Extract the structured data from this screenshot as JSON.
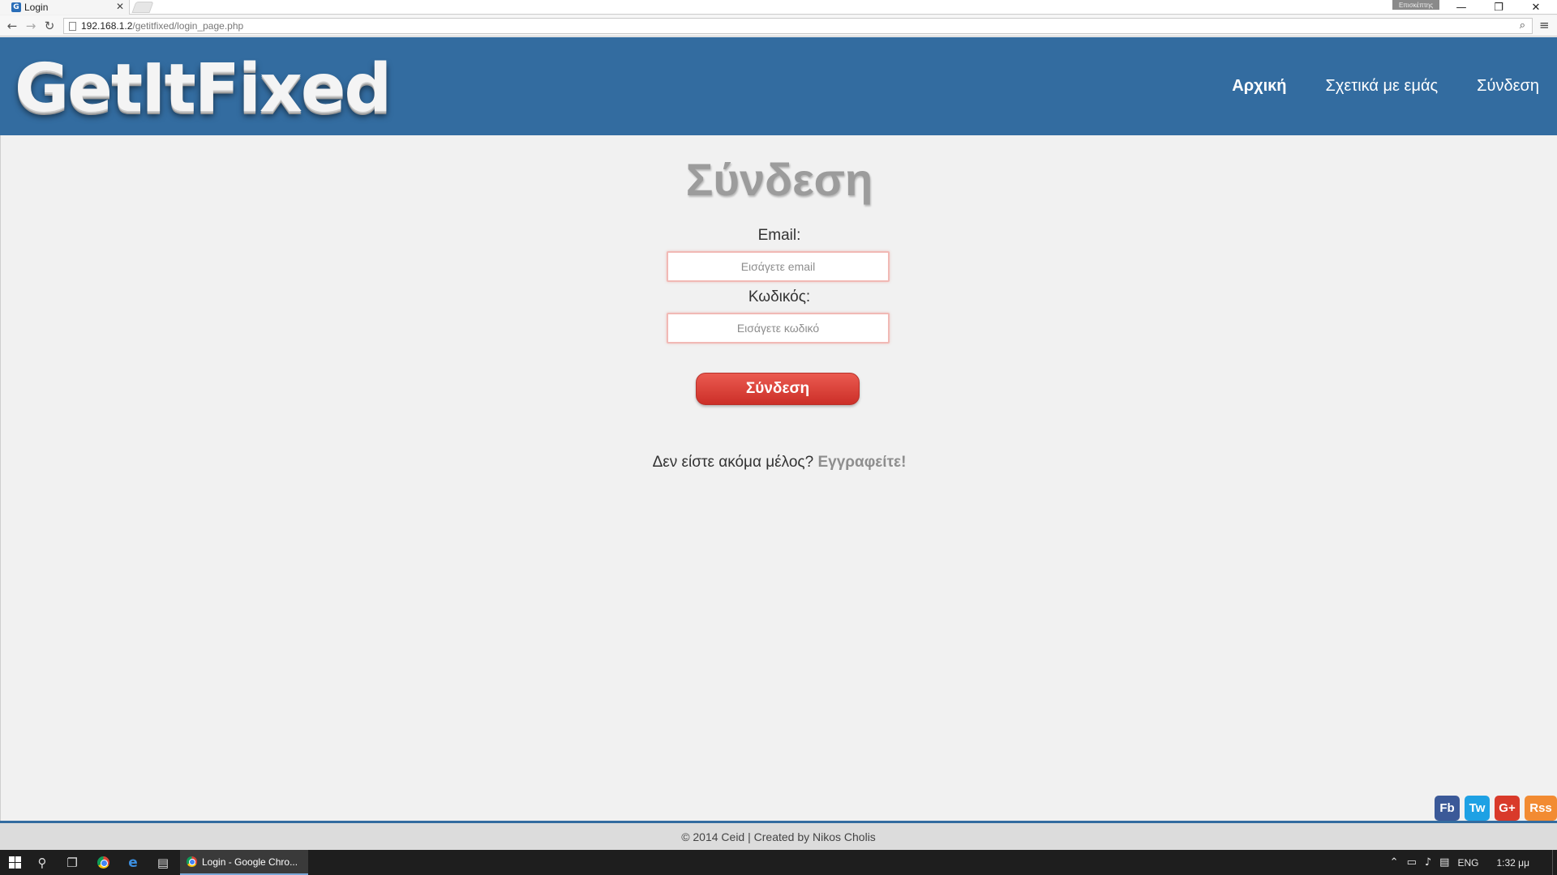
{
  "browser": {
    "tab_title": "Login",
    "tab_favicon": "G",
    "profile_badge": "Επισκέπτης",
    "url_host": "192.168.1.2",
    "url_path": "/getitfixed/login_page.php"
  },
  "site": {
    "logo": "GetItFixed",
    "nav": {
      "home": "Αρχική",
      "about": "Σχετικά με εμάς",
      "login": "Σύνδεση"
    }
  },
  "login": {
    "title": "Σύνδεση",
    "email_label": "Email:",
    "email_placeholder": "Εισάγετε email",
    "password_label": "Κωδικός:",
    "password_placeholder": "Εισάγετε κωδικό",
    "submit_label": "Σύνδεση",
    "register_prompt": "Δεν είστε ακόμα μέλος?",
    "register_link": "Εγγραφείτε!"
  },
  "social": {
    "facebook": "Fb",
    "twitter": "Tw",
    "google_plus": "G+",
    "rss": "Rss"
  },
  "footer": {
    "text": "© 2014 Ceid | Created by Nikos Cholis"
  },
  "taskbar": {
    "active_app": "Login - Google Chro...",
    "language": "ENG",
    "clock": "1:32 μμ"
  },
  "colors": {
    "header_bg": "#336ca0",
    "button_red": "#e0453c",
    "page_bg": "#f1f1f1"
  }
}
